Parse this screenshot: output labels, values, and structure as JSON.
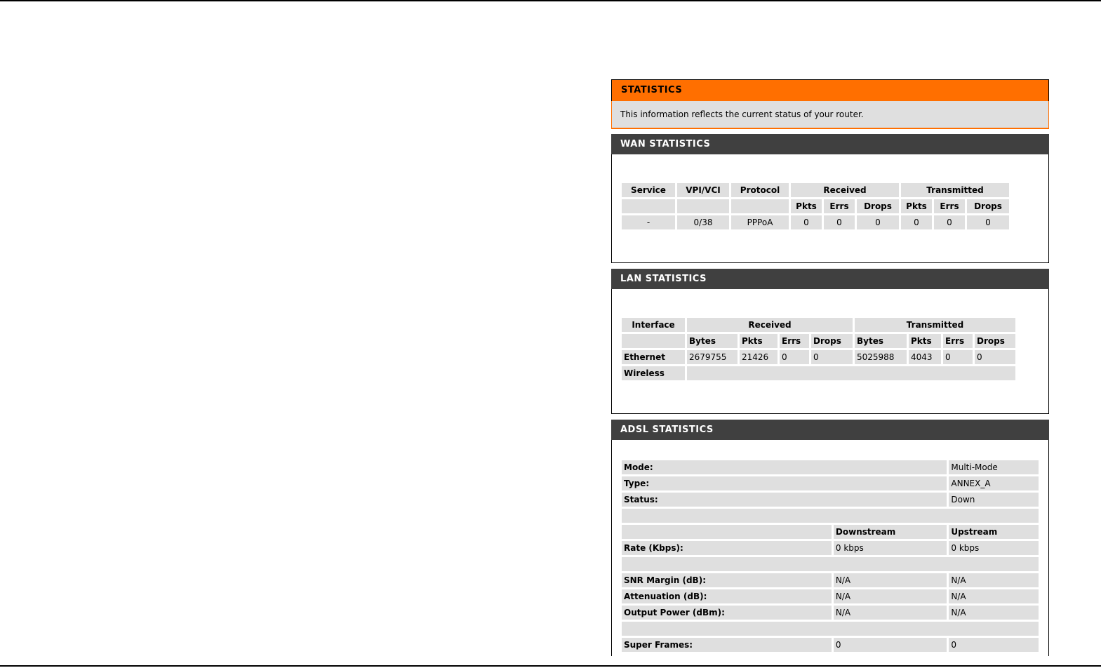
{
  "statistics": {
    "title": "STATISTICS",
    "description": "This information reflects the current status of your router."
  },
  "wan": {
    "title": "WAN STATISTICS",
    "headers": [
      "Service",
      "VPI/VCI",
      "Protocol",
      "Received",
      "Transmitted"
    ],
    "subheaders": [
      "Pkts",
      "Errs",
      "Drops",
      "Pkts",
      "Errs",
      "Drops"
    ],
    "row": [
      "-",
      "0/38",
      "PPPoA",
      "0",
      "0",
      "0",
      "0",
      "0",
      "0"
    ]
  },
  "lan": {
    "title": "LAN STATISTICS",
    "headers": [
      "Interface",
      "Received",
      "Transmitted"
    ],
    "subheaders": [
      "Bytes",
      "Pkts",
      "Errs",
      "Drops",
      "Bytes",
      "Pkts",
      "Errs",
      "Drops"
    ],
    "ethernet": [
      "Ethernet",
      "2679755",
      "21426",
      "0",
      "0",
      "5025988",
      "4043",
      "0",
      "0"
    ],
    "wireless": "Wireless"
  },
  "adsl": {
    "title": "ADSL STATISTICS",
    "mode_label": "Mode:",
    "mode_value": "Multi-Mode",
    "type_label": "Type:",
    "type_value": "ANNEX_A",
    "status_label": "Status:",
    "status_value": "Down",
    "downstream": "Downstream",
    "upstream": "Upstream",
    "rate_label": "Rate (Kbps):",
    "rate_down": "0 kbps",
    "rate_up": "0 kbps",
    "snr_label": "SNR Margin (dB):",
    "snr_down": "N/A",
    "snr_up": "N/A",
    "att_label": "Attenuation (dB):",
    "att_down": "N/A",
    "att_up": "N/A",
    "power_label": "Output Power (dBm):",
    "power_down": "N/A",
    "power_up": "N/A",
    "sf_label": "Super Frames:",
    "sf_down": "0",
    "sf_up": "0"
  }
}
